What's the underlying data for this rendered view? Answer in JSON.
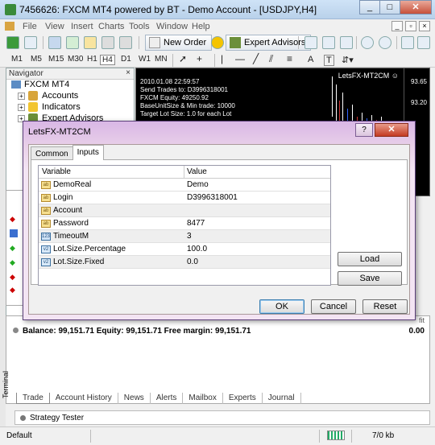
{
  "window": {
    "title": "7456626: FXCM MT4 powered by BT - Demo Account - [USDJPY,H4]",
    "controls": {
      "minimize": "_",
      "maximize": "□",
      "close": "✕"
    }
  },
  "menu": {
    "items": [
      "File",
      "View",
      "Insert",
      "Charts",
      "Tools",
      "Window",
      "Help"
    ]
  },
  "toolbar": {
    "new_order_label": "New Order",
    "expert_advisors_label": "Expert Advisors"
  },
  "timeframes": [
    "M1",
    "M5",
    "M15",
    "M30",
    "H1",
    "H4",
    "D1",
    "W1",
    "MN"
  ],
  "drawing_tools": {
    "text_tool": "A",
    "label_tool": "T"
  },
  "navigator": {
    "title": "Navigator",
    "close": "×",
    "root": "FXCM MT4",
    "items": [
      "Accounts",
      "Indicators",
      "Expert Advisors"
    ]
  },
  "chart": {
    "info_lines": [
      "2010.01.08 22:59:57",
      "Send Trades to: D3996318001",
      "FXCM Equity: 49250.92",
      "BaseUnitSize & Min trade: 10000",
      "Target Lot Size: 1.0 for each Lot"
    ],
    "symbol_label": "LetsFX-MT2CM ☺",
    "price_ticks": [
      "93.65",
      "93.20"
    ]
  },
  "dialog": {
    "title": "LetsFX-MT2CM",
    "help": "?",
    "close": "✕",
    "tabs": [
      "Common",
      "Inputs"
    ],
    "active_tab": "Inputs",
    "columns": {
      "variable": "Variable",
      "value": "Value"
    },
    "inputs": [
      {
        "type": "ab",
        "name": "DemoReal",
        "value": "Demo"
      },
      {
        "type": "ab",
        "name": "Login",
        "value": "D3996318001"
      },
      {
        "type": "ab",
        "name": "Account",
        "value": ""
      },
      {
        "type": "ab",
        "name": "Password",
        "value": "8477"
      },
      {
        "type": "123",
        "name": "TimeoutM",
        "value": "3"
      },
      {
        "type": "v2",
        "name": "Lot.Size.Percentage",
        "value": "100.0"
      },
      {
        "type": "v2",
        "name": "Lot.Size.Fixed",
        "value": "0.0"
      }
    ],
    "buttons": {
      "load": "Load",
      "save": "Save",
      "ok": "OK",
      "cancel": "Cancel",
      "reset": "Reset"
    }
  },
  "terminal": {
    "side_label": "Terminal",
    "balance_line": "Balance: 99,151.71  Equity: 99,151.71  Free margin: 99,151.71",
    "profit": "0.00",
    "header_fragment": "fit",
    "tabs": [
      "Trade",
      "Account History",
      "News",
      "Alerts",
      "Mailbox",
      "Experts",
      "Journal"
    ],
    "active_tab": "Trade",
    "strategy_tester": "Strategy Tester"
  },
  "status": {
    "left": "Default",
    "traffic": "7/0 kb"
  }
}
